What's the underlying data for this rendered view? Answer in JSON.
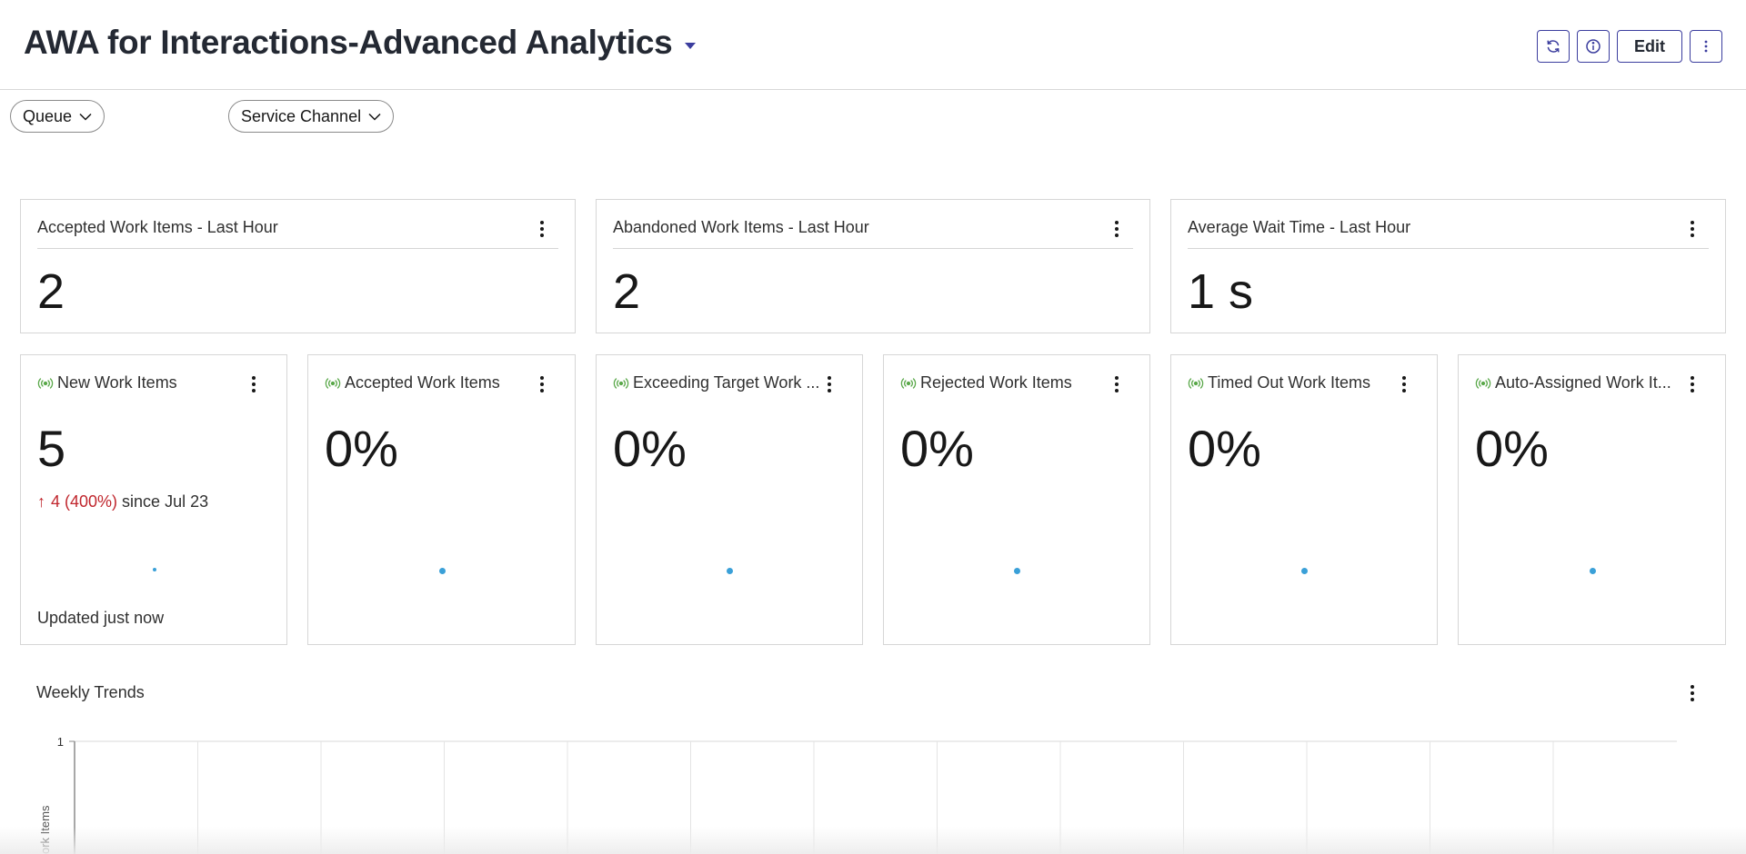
{
  "header": {
    "title": "AWA for Interactions-Advanced Analytics",
    "refresh_icon": "refresh-icon",
    "info_icon": "info-icon",
    "edit_label": "Edit",
    "more_icon": "kebab-icon"
  },
  "filters": [
    {
      "label": "Queue"
    },
    {
      "label": "Service Channel"
    }
  ],
  "summary_cards": [
    {
      "title": "Accepted Work Items - Last Hour",
      "value": "2"
    },
    {
      "title": "Abandoned Work Items - Last Hour",
      "value": "2"
    },
    {
      "title": "Average Wait Time - Last Hour",
      "value": "1 s"
    }
  ],
  "metric_cards": [
    {
      "title": "New Work Items",
      "value": "5",
      "delta_arrow": "↑",
      "delta_change": "4 (400%)",
      "delta_since": "since Jul 23",
      "updated": "Updated just now"
    },
    {
      "title": "Accepted Work Items",
      "value": "0%"
    },
    {
      "title": "Exceeding Target Work ...",
      "value": "0%"
    },
    {
      "title": "Rejected Work Items",
      "value": "0%"
    },
    {
      "title": "Timed Out Work Items",
      "value": "0%"
    },
    {
      "title": "Auto-Assigned Work It...",
      "value": "0%"
    }
  ],
  "weekly_trends": {
    "title": "Weekly Trends"
  },
  "chart_data": {
    "type": "line",
    "title": "Weekly Trends",
    "ylabel": "ork Items",
    "yticks": [
      "1"
    ],
    "ylim": [
      0,
      1
    ],
    "grid": true,
    "series": []
  },
  "colors": {
    "accent": "#3b3d9e",
    "live_green": "#5aa84a",
    "delta_red": "#c0262d",
    "sparkline_dot": "#3aa0d8",
    "border": "#d6d6d6"
  }
}
